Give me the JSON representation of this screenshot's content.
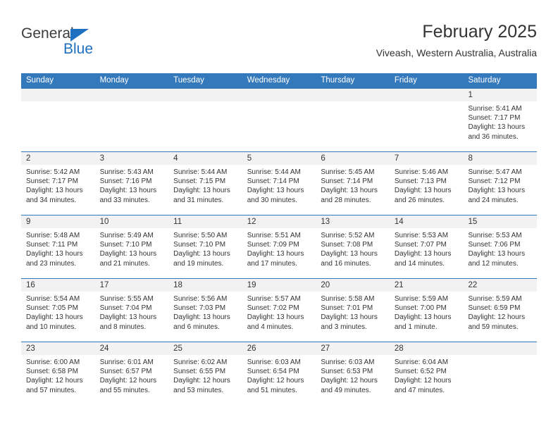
{
  "brand": {
    "name_part1": "General",
    "name_part2": "Blue",
    "accent_color": "#1f70c1",
    "triangle_icon": "triangle-icon"
  },
  "header": {
    "title": "February 2025",
    "subtitle": "Viveash, Western Australia, Australia",
    "header_bg_color": "#3479bb",
    "daynum_band_color": "#f2f2f2"
  },
  "weekday_headers": [
    "Sunday",
    "Monday",
    "Tuesday",
    "Wednesday",
    "Thursday",
    "Friday",
    "Saturday"
  ],
  "weeks": [
    [
      {
        "day": "",
        "sunrise": "",
        "sunset": "",
        "daylight_line1": "",
        "daylight_line2": ""
      },
      {
        "day": "",
        "sunrise": "",
        "sunset": "",
        "daylight_line1": "",
        "daylight_line2": ""
      },
      {
        "day": "",
        "sunrise": "",
        "sunset": "",
        "daylight_line1": "",
        "daylight_line2": ""
      },
      {
        "day": "",
        "sunrise": "",
        "sunset": "",
        "daylight_line1": "",
        "daylight_line2": ""
      },
      {
        "day": "",
        "sunrise": "",
        "sunset": "",
        "daylight_line1": "",
        "daylight_line2": ""
      },
      {
        "day": "",
        "sunrise": "",
        "sunset": "",
        "daylight_line1": "",
        "daylight_line2": ""
      },
      {
        "day": "1",
        "sunrise": "Sunrise: 5:41 AM",
        "sunset": "Sunset: 7:17 PM",
        "daylight_line1": "Daylight: 13 hours",
        "daylight_line2": "and 36 minutes."
      }
    ],
    [
      {
        "day": "2",
        "sunrise": "Sunrise: 5:42 AM",
        "sunset": "Sunset: 7:17 PM",
        "daylight_line1": "Daylight: 13 hours",
        "daylight_line2": "and 34 minutes."
      },
      {
        "day": "3",
        "sunrise": "Sunrise: 5:43 AM",
        "sunset": "Sunset: 7:16 PM",
        "daylight_line1": "Daylight: 13 hours",
        "daylight_line2": "and 33 minutes."
      },
      {
        "day": "4",
        "sunrise": "Sunrise: 5:44 AM",
        "sunset": "Sunset: 7:15 PM",
        "daylight_line1": "Daylight: 13 hours",
        "daylight_line2": "and 31 minutes."
      },
      {
        "day": "5",
        "sunrise": "Sunrise: 5:44 AM",
        "sunset": "Sunset: 7:14 PM",
        "daylight_line1": "Daylight: 13 hours",
        "daylight_line2": "and 30 minutes."
      },
      {
        "day": "6",
        "sunrise": "Sunrise: 5:45 AM",
        "sunset": "Sunset: 7:14 PM",
        "daylight_line1": "Daylight: 13 hours",
        "daylight_line2": "and 28 minutes."
      },
      {
        "day": "7",
        "sunrise": "Sunrise: 5:46 AM",
        "sunset": "Sunset: 7:13 PM",
        "daylight_line1": "Daylight: 13 hours",
        "daylight_line2": "and 26 minutes."
      },
      {
        "day": "8",
        "sunrise": "Sunrise: 5:47 AM",
        "sunset": "Sunset: 7:12 PM",
        "daylight_line1": "Daylight: 13 hours",
        "daylight_line2": "and 24 minutes."
      }
    ],
    [
      {
        "day": "9",
        "sunrise": "Sunrise: 5:48 AM",
        "sunset": "Sunset: 7:11 PM",
        "daylight_line1": "Daylight: 13 hours",
        "daylight_line2": "and 23 minutes."
      },
      {
        "day": "10",
        "sunrise": "Sunrise: 5:49 AM",
        "sunset": "Sunset: 7:10 PM",
        "daylight_line1": "Daylight: 13 hours",
        "daylight_line2": "and 21 minutes."
      },
      {
        "day": "11",
        "sunrise": "Sunrise: 5:50 AM",
        "sunset": "Sunset: 7:10 PM",
        "daylight_line1": "Daylight: 13 hours",
        "daylight_line2": "and 19 minutes."
      },
      {
        "day": "12",
        "sunrise": "Sunrise: 5:51 AM",
        "sunset": "Sunset: 7:09 PM",
        "daylight_line1": "Daylight: 13 hours",
        "daylight_line2": "and 17 minutes."
      },
      {
        "day": "13",
        "sunrise": "Sunrise: 5:52 AM",
        "sunset": "Sunset: 7:08 PM",
        "daylight_line1": "Daylight: 13 hours",
        "daylight_line2": "and 16 minutes."
      },
      {
        "day": "14",
        "sunrise": "Sunrise: 5:53 AM",
        "sunset": "Sunset: 7:07 PM",
        "daylight_line1": "Daylight: 13 hours",
        "daylight_line2": "and 14 minutes."
      },
      {
        "day": "15",
        "sunrise": "Sunrise: 5:53 AM",
        "sunset": "Sunset: 7:06 PM",
        "daylight_line1": "Daylight: 13 hours",
        "daylight_line2": "and 12 minutes."
      }
    ],
    [
      {
        "day": "16",
        "sunrise": "Sunrise: 5:54 AM",
        "sunset": "Sunset: 7:05 PM",
        "daylight_line1": "Daylight: 13 hours",
        "daylight_line2": "and 10 minutes."
      },
      {
        "day": "17",
        "sunrise": "Sunrise: 5:55 AM",
        "sunset": "Sunset: 7:04 PM",
        "daylight_line1": "Daylight: 13 hours",
        "daylight_line2": "and 8 minutes."
      },
      {
        "day": "18",
        "sunrise": "Sunrise: 5:56 AM",
        "sunset": "Sunset: 7:03 PM",
        "daylight_line1": "Daylight: 13 hours",
        "daylight_line2": "and 6 minutes."
      },
      {
        "day": "19",
        "sunrise": "Sunrise: 5:57 AM",
        "sunset": "Sunset: 7:02 PM",
        "daylight_line1": "Daylight: 13 hours",
        "daylight_line2": "and 4 minutes."
      },
      {
        "day": "20",
        "sunrise": "Sunrise: 5:58 AM",
        "sunset": "Sunset: 7:01 PM",
        "daylight_line1": "Daylight: 13 hours",
        "daylight_line2": "and 3 minutes."
      },
      {
        "day": "21",
        "sunrise": "Sunrise: 5:59 AM",
        "sunset": "Sunset: 7:00 PM",
        "daylight_line1": "Daylight: 13 hours",
        "daylight_line2": "and 1 minute."
      },
      {
        "day": "22",
        "sunrise": "Sunrise: 5:59 AM",
        "sunset": "Sunset: 6:59 PM",
        "daylight_line1": "Daylight: 12 hours",
        "daylight_line2": "and 59 minutes."
      }
    ],
    [
      {
        "day": "23",
        "sunrise": "Sunrise: 6:00 AM",
        "sunset": "Sunset: 6:58 PM",
        "daylight_line1": "Daylight: 12 hours",
        "daylight_line2": "and 57 minutes."
      },
      {
        "day": "24",
        "sunrise": "Sunrise: 6:01 AM",
        "sunset": "Sunset: 6:57 PM",
        "daylight_line1": "Daylight: 12 hours",
        "daylight_line2": "and 55 minutes."
      },
      {
        "day": "25",
        "sunrise": "Sunrise: 6:02 AM",
        "sunset": "Sunset: 6:55 PM",
        "daylight_line1": "Daylight: 12 hours",
        "daylight_line2": "and 53 minutes."
      },
      {
        "day": "26",
        "sunrise": "Sunrise: 6:03 AM",
        "sunset": "Sunset: 6:54 PM",
        "daylight_line1": "Daylight: 12 hours",
        "daylight_line2": "and 51 minutes."
      },
      {
        "day": "27",
        "sunrise": "Sunrise: 6:03 AM",
        "sunset": "Sunset: 6:53 PM",
        "daylight_line1": "Daylight: 12 hours",
        "daylight_line2": "and 49 minutes."
      },
      {
        "day": "28",
        "sunrise": "Sunrise: 6:04 AM",
        "sunset": "Sunset: 6:52 PM",
        "daylight_line1": "Daylight: 12 hours",
        "daylight_line2": "and 47 minutes."
      },
      {
        "day": "",
        "sunrise": "",
        "sunset": "",
        "daylight_line1": "",
        "daylight_line2": ""
      }
    ]
  ]
}
